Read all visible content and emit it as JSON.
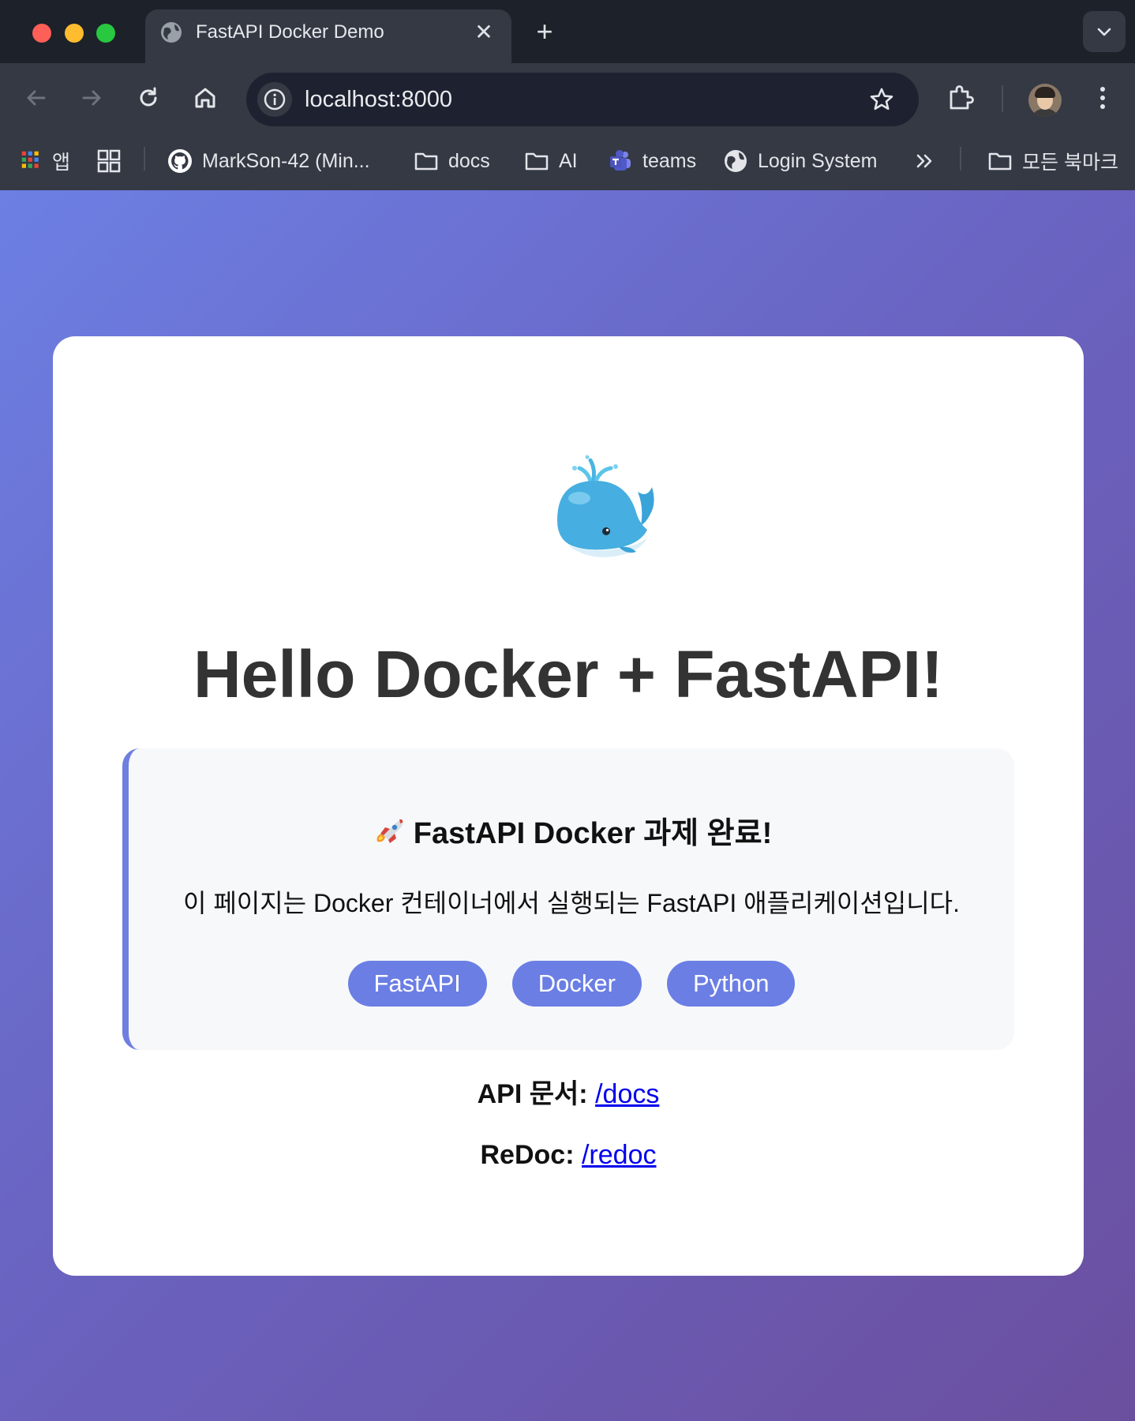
{
  "browser": {
    "tab_title": "FastAPI Docker Demo",
    "url": "localhost:8000",
    "bookmarks": {
      "apps": "앱",
      "github": "MarkSon-42 (Min...",
      "docs": "docs",
      "ai": "AI",
      "teams": "teams",
      "login_system": "Login System",
      "all_bookmarks": "모든 북마크"
    }
  },
  "page": {
    "title": "Hello Docker + FastAPI!",
    "info_title": "FastAPI Docker 과제 완료!",
    "info_desc": "이 페이지는 Docker 컨테이너에서 실행되는 FastAPI 애플리케이션입니다.",
    "tags": [
      "FastAPI",
      "Docker",
      "Python"
    ],
    "api_docs_label": "API 문서:",
    "api_docs_link": "/docs",
    "redoc_label": "ReDoc:",
    "redoc_link": "/redoc"
  },
  "colors": {
    "accent": "#6b7ee4",
    "gradient_start": "#6c7fe3",
    "gradient_end": "#6b4f9f",
    "link": "#0000ee"
  }
}
